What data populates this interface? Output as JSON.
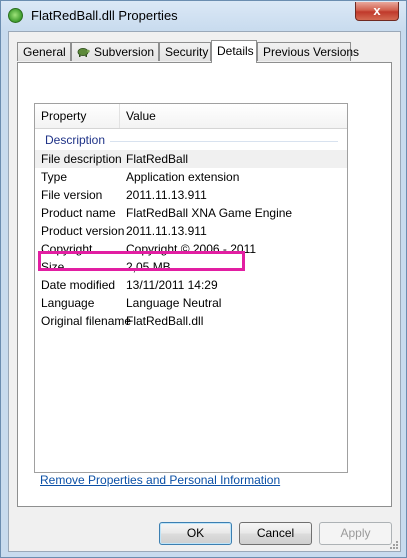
{
  "window": {
    "title": "FlatRedBall.dll Properties",
    "close_glyph": "x",
    "icon": "green-ball-icon"
  },
  "tabs": [
    {
      "label": "General"
    },
    {
      "label": "Subversion",
      "icon": "turtle-icon"
    },
    {
      "label": "Security"
    },
    {
      "label": "Details",
      "active": true
    },
    {
      "label": "Previous Versions"
    }
  ],
  "details": {
    "columns": {
      "property": "Property",
      "value": "Value"
    },
    "group": "Description",
    "rows": [
      {
        "property": "File description",
        "value": "FlatRedBall"
      },
      {
        "property": "Type",
        "value": "Application extension"
      },
      {
        "property": "File version",
        "value": "2011.11.13.911"
      },
      {
        "property": "Product name",
        "value": "FlatRedBall XNA Game Engine"
      },
      {
        "property": "Product version",
        "value": "2011.11.13.911"
      },
      {
        "property": "Copyright",
        "value": "Copyright ©  2006 - 2011"
      },
      {
        "property": "Size",
        "value": "2,05 MB"
      },
      {
        "property": "Date modified",
        "value": "13/11/2011 14:29"
      },
      {
        "property": "Language",
        "value": "Language Neutral"
      },
      {
        "property": "Original filename",
        "value": "FlatRedBall.dll"
      }
    ],
    "selected_row": 0,
    "highlighted_row": 4
  },
  "link": {
    "remove": "Remove Properties and Personal Information"
  },
  "buttons": {
    "ok": "OK",
    "cancel": "Cancel",
    "apply": "Apply"
  },
  "colors": {
    "highlight": "#e21ea2",
    "link": "#0b50a6",
    "group_header": "#1e3287",
    "close_button": "#c0392b"
  }
}
